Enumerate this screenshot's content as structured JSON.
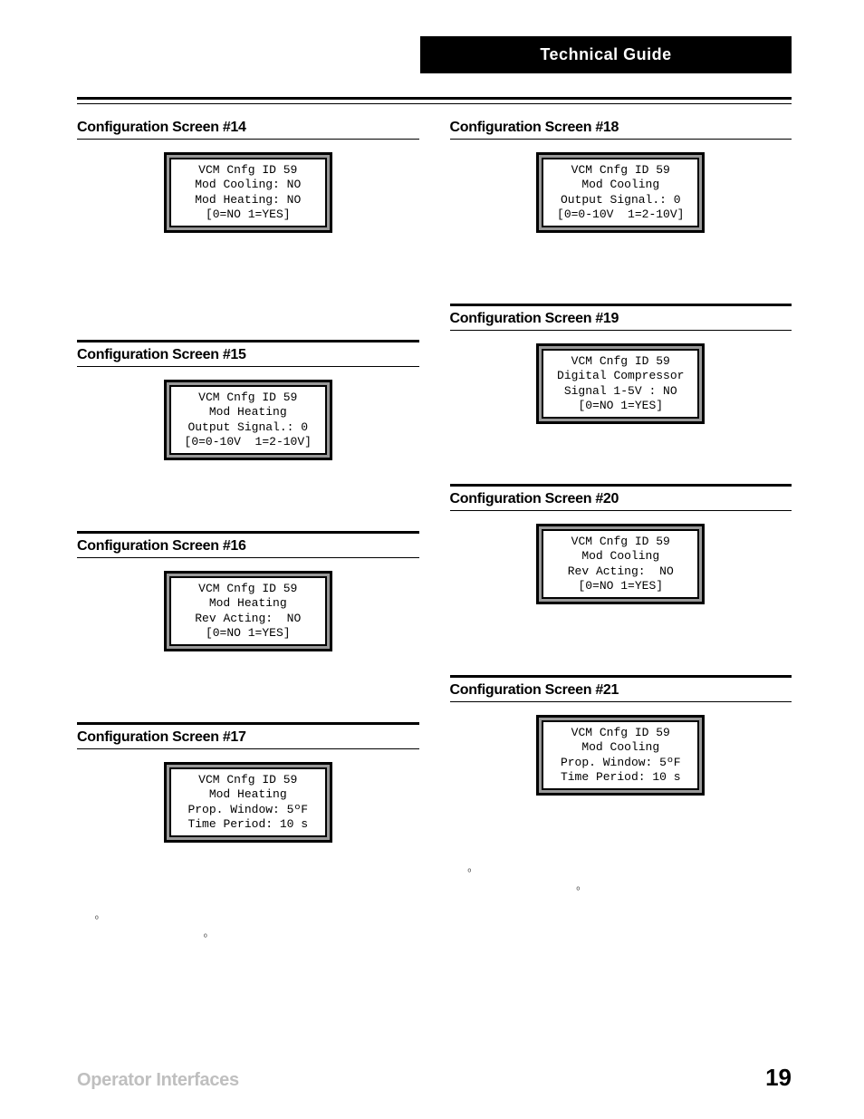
{
  "header": {
    "title": "Technical Guide"
  },
  "left": {
    "s14": {
      "title": "Configuration Screen #14",
      "lcd": "VCM Cnfg ID 59\nMod Cooling: NO\nMod Heating: NO\n[0=NO 1=YES]"
    },
    "s15": {
      "title": "Configuration Screen #15",
      "lcd": "VCM Cnfg ID 59\nMod Heating\nOutput Signal.: 0\n[0=0-10V  1=2-10V]"
    },
    "s16": {
      "title": "Configuration Screen #16",
      "lcd": "VCM Cnfg ID 59\nMod Heating\nRev Acting:  NO\n[0=NO 1=YES]"
    },
    "s17": {
      "title": "Configuration Screen #17",
      "lcd": "VCM Cnfg ID 59\nMod Heating\nProp. Window: 5ºF\nTime Period: 10 s"
    }
  },
  "right": {
    "s18": {
      "title": "Configuration Screen #18",
      "lcd": "VCM Cnfg ID 59\nMod Cooling\nOutput Signal.: 0\n[0=0-10V  1=2-10V]"
    },
    "s19": {
      "title": "Configuration Screen #19",
      "lcd": "VCM Cnfg ID 59\nDigital Compressor\nSignal 1-5V : NO\n[0=NO 1=YES]"
    },
    "s20": {
      "title": "Configuration Screen #20",
      "lcd": "VCM Cnfg ID 59\nMod Cooling\nRev Acting:  NO\n[0=NO 1=YES]"
    },
    "s21": {
      "title": "Configuration Screen #21",
      "lcd": "VCM Cnfg ID 59\nMod Cooling\nProp. Window: 5ºF\nTime Period: 10 s"
    }
  },
  "footer": {
    "left": "Operator Interfaces",
    "page": "19"
  },
  "marks": {
    "deg": "º"
  }
}
